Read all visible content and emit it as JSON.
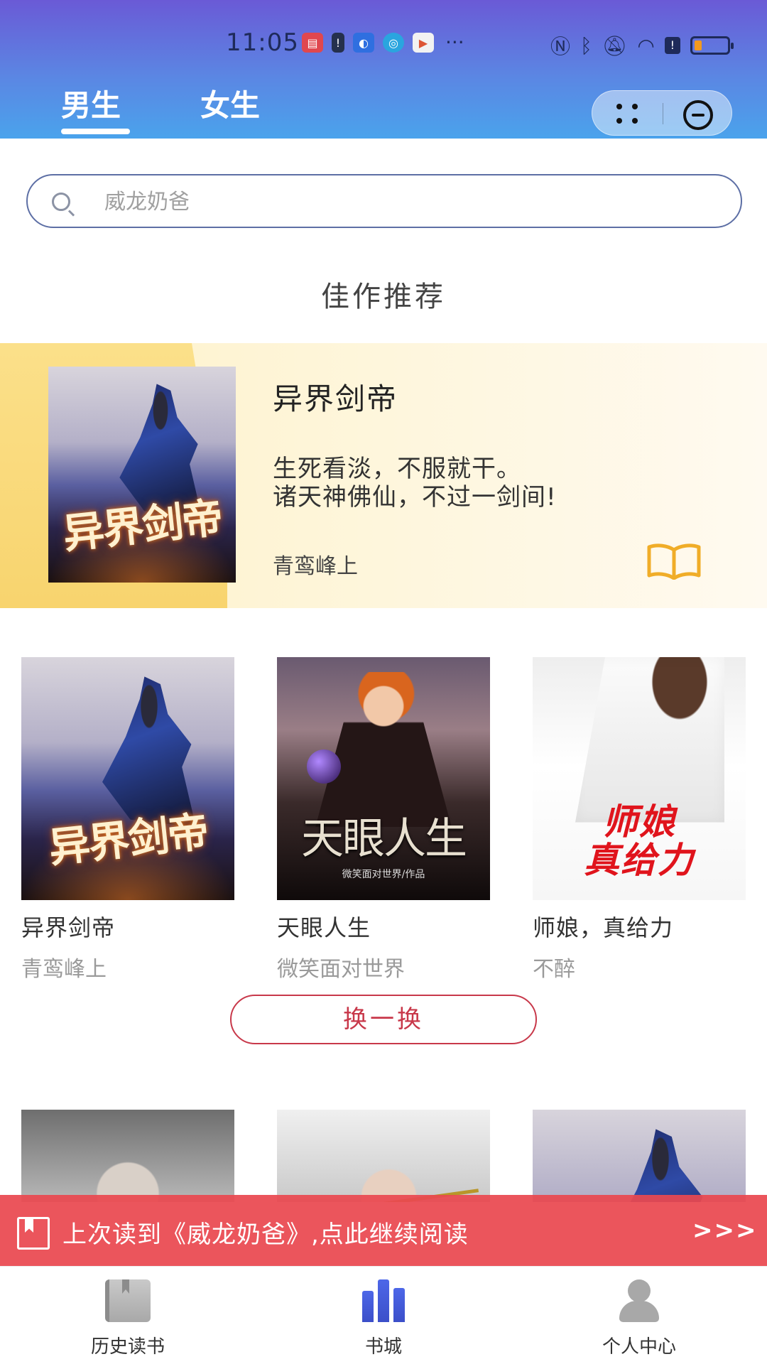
{
  "status_bar": {
    "time": "11:05",
    "dots": "···"
  },
  "tabs": [
    {
      "label": "男生",
      "active": true
    },
    {
      "label": "女生",
      "active": false
    }
  ],
  "search": {
    "placeholder": "威龙奶爸"
  },
  "section_title": "佳作推荐",
  "featured": {
    "title": "异界剑帝",
    "desc_line1": "生死看淡，不服就干。",
    "desc_line2": "诸天神佛仙，不过一剑间!",
    "author": "青鸾峰上",
    "cover_text": "异界剑帝"
  },
  "books": [
    {
      "title": "异界剑帝",
      "author": "青鸾峰上",
      "cover_text": "异界剑帝"
    },
    {
      "title": "天眼人生",
      "author": "微笑面对世界",
      "cover_text": "天眼人生",
      "cover_sub": "微笑面对世界/作品"
    },
    {
      "title": "师娘，真给力",
      "author": "不醉",
      "cover_line1": "师娘",
      "cover_line2": "真给力"
    }
  ],
  "refresh_label": "换一换",
  "continue_banner": {
    "text": "上次读到《威龙奶爸》,点此继续阅读",
    "arrows": ">>>"
  },
  "bottom_nav": [
    {
      "label": "历史读书",
      "icon": "book-icon"
    },
    {
      "label": "书城",
      "icon": "bookshelf-icon",
      "active": true
    },
    {
      "label": "个人中心",
      "icon": "person-icon"
    }
  ],
  "colors": {
    "header_gradient_top": "#6a5ad6",
    "header_gradient_bottom": "#4aa3ec",
    "accent_red": "#c8384a",
    "banner_red": "#e94850",
    "store_blue": "#4d67e8"
  }
}
